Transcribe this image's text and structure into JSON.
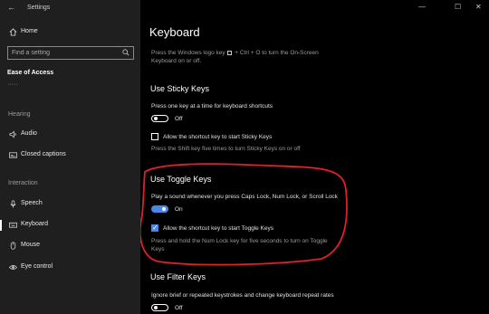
{
  "app": {
    "title": "Settings"
  },
  "sidebar": {
    "home_label": "Home",
    "search_placeholder": "Find a setting",
    "category": "Ease of Access",
    "overflow_indicator": "·····",
    "hearing_header": "Hearing",
    "hearing_items": [
      {
        "label": "Audio",
        "icon": "speaker-icon"
      },
      {
        "label": "Closed captions",
        "icon": "captions-icon"
      }
    ],
    "interaction_header": "Interaction",
    "interaction_items": [
      {
        "label": "Speech",
        "icon": "microphone-icon"
      },
      {
        "label": "Keyboard",
        "icon": "keyboard-icon",
        "active": true
      },
      {
        "label": "Mouse",
        "icon": "mouse-icon"
      },
      {
        "label": "Eye control",
        "icon": "eye-icon"
      }
    ]
  },
  "window_controls": {
    "minimize": "—",
    "maximize": "☐",
    "close": "✕"
  },
  "main": {
    "title": "Keyboard",
    "onscreen_line1_prefix": "Press the Windows logo key",
    "onscreen_line1_suffix": " + Ctrl + O to turn the On-Screen",
    "onscreen_line2": "Keyboard on or off.",
    "sticky": {
      "heading": "Use Sticky Keys",
      "description": "Press one key at a time for keyboard shortcuts",
      "toggle_state": "Off",
      "checkbox_label": "Allow the shortcut key to start Sticky Keys",
      "hint": "Press the Shift key five times to turn Sticky Keys on or off"
    },
    "toggle_keys": {
      "heading": "Use Toggle Keys",
      "description": "Play a sound whenever you press Caps Lock, Num Lock, or Scroll Lock",
      "toggle_state": "On",
      "checkbox_label": "Allow the shortcut key to start Toggle Keys",
      "hint_line1": "Press and hold the Num Lock key for five seconds to turn on Toggle",
      "hint_line2": "Keys"
    },
    "filter": {
      "heading": "Use Filter Keys",
      "description": "Ignore brief or repeated keystrokes and change keyboard repeat rates",
      "toggle_state": "Off"
    }
  },
  "colors": {
    "accent": "#4a88e8",
    "annotation": "#e0202a",
    "sidebar_bg": "#1f1f1f"
  }
}
